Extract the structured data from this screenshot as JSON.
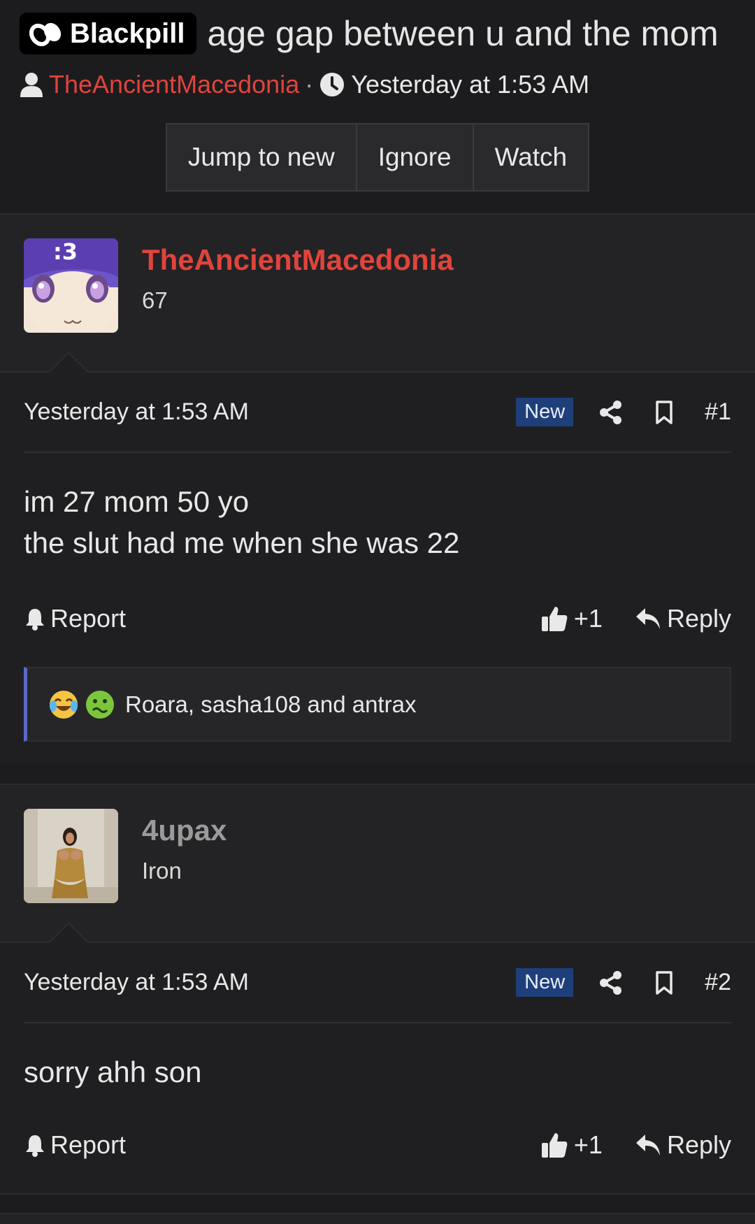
{
  "header": {
    "prefix": "Blackpill",
    "title": "age gap between u and the mom",
    "author": "TheAncientMacedonia",
    "separator": "·",
    "time": "Yesterday at 1:53 AM",
    "buttons": [
      "Jump to new",
      "Ignore",
      "Watch"
    ]
  },
  "posts": [
    {
      "username": "TheAncientMacedonia",
      "user_title": "67",
      "avatar_text": ":3",
      "date": "Yesterday at 1:53 AM",
      "badge": "New",
      "number": "#1",
      "content_lines": [
        "im 27 mom 50 yo",
        "the slut had me when she was 22"
      ],
      "report": "Report",
      "like": "+1",
      "reply": "Reply",
      "reactions": "Roara, sasha108 and antrax"
    },
    {
      "username": "4upax",
      "user_title": "Iron",
      "date": "Yesterday at 1:53 AM",
      "badge": "New",
      "number": "#2",
      "content_lines": [
        "sorry ahh son"
      ],
      "report": "Report",
      "like": "+1",
      "reply": "Reply"
    }
  ],
  "colors": {
    "background": "#1c1c1e",
    "author_red": "#e0443c",
    "new_badge": "#1e3f7a",
    "reaction_border": "#5a68c8"
  },
  "icons": [
    "user-icon",
    "clock-icon",
    "share-icon",
    "bookmark-icon",
    "bell-icon",
    "thumbs-up-icon",
    "reply-icon",
    "joy-emoji-icon",
    "sick-emoji-icon"
  ]
}
